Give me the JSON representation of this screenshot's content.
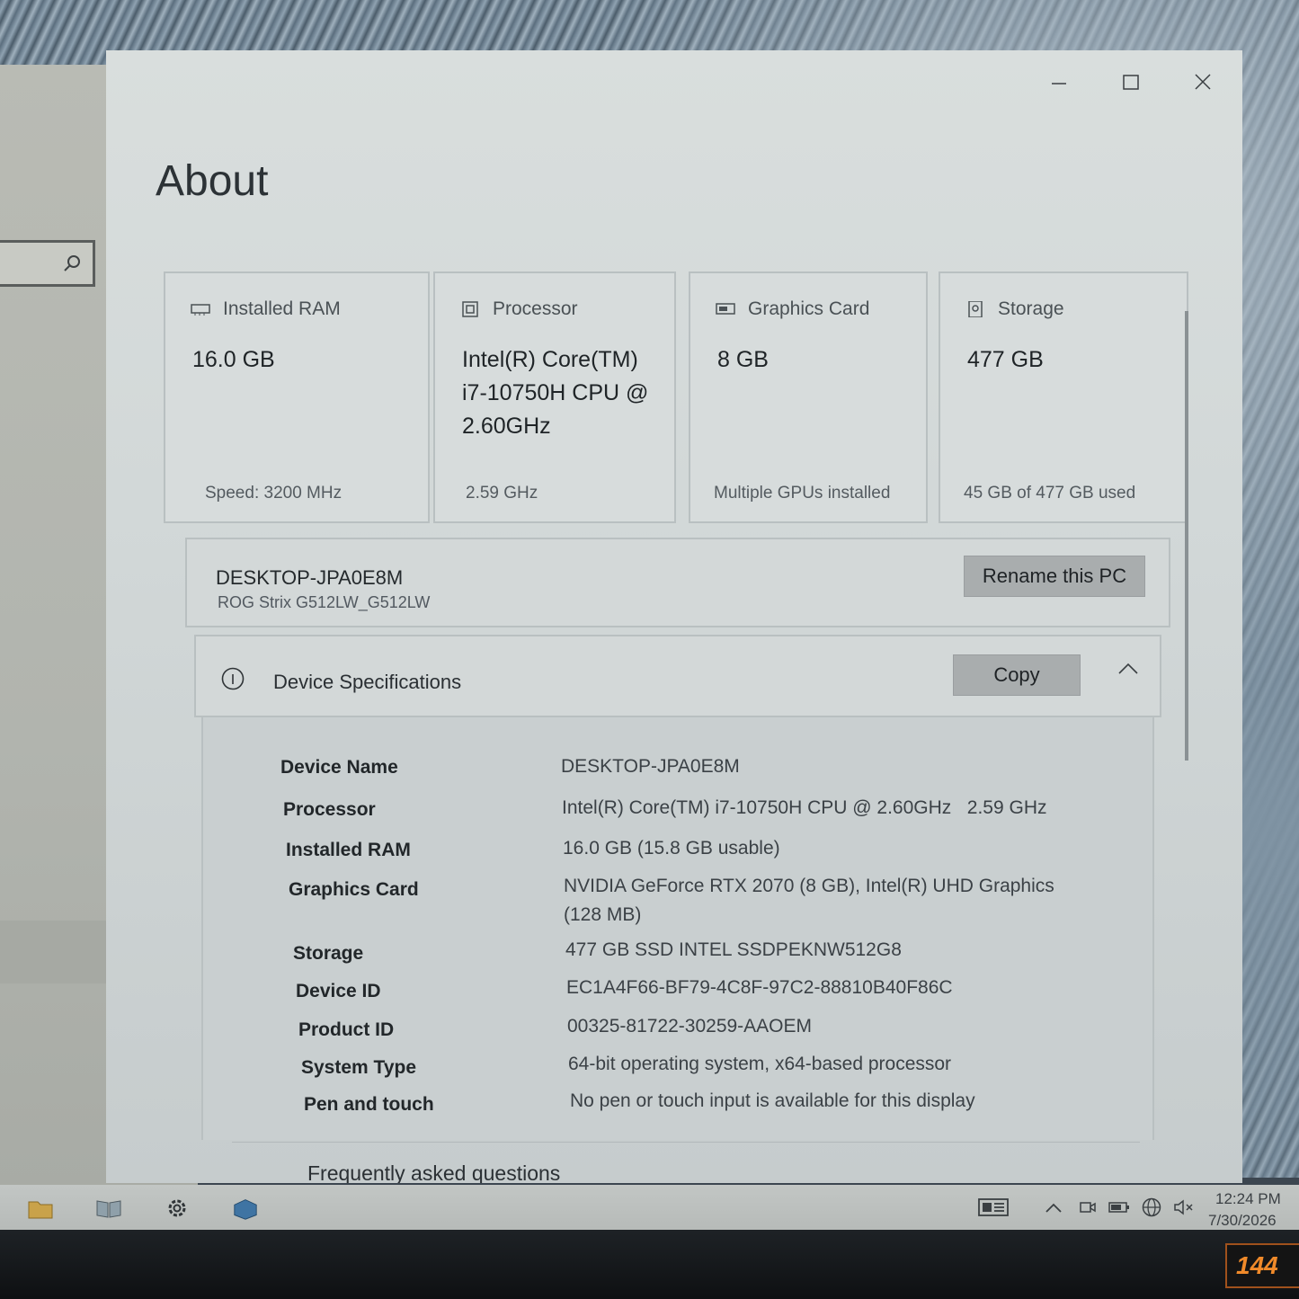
{
  "window": {
    "title": "About",
    "minimize_icon": "minimize-icon",
    "maximize_icon": "maximize-icon",
    "close_icon": "close-icon"
  },
  "cards": [
    {
      "label": "Installed RAM",
      "value": "16.0 GB",
      "sub": "Speed: 3200 MHz",
      "icon": "ram-icon"
    },
    {
      "label": "Processor",
      "value": "Intel(R) Core(TM) i7-10750H CPU @ 2.60GHz",
      "sub": "2.59 GHz",
      "icon": "processor-icon"
    },
    {
      "label": "Graphics Card",
      "value": "8 GB",
      "sub": "Multiple GPUs installed",
      "icon": "graphics-card-icon"
    },
    {
      "label": "Storage",
      "value": "477 GB",
      "sub": "45 GB of 477 GB used",
      "icon": "storage-icon"
    }
  ],
  "pc": {
    "name": "DESKTOP-JPA0E8M",
    "model": "ROG Strix G512LW_G512LW",
    "rename_label": "Rename this PC"
  },
  "specs": {
    "header": "Device Specifications",
    "copy_label": "Copy",
    "rows": [
      {
        "key": "Device Name",
        "value": "DESKTOP-JPA0E8M"
      },
      {
        "key": "Processor",
        "value": "Intel(R) Core(TM) i7-10750H CPU @ 2.60GHz   2.59 GHz"
      },
      {
        "key": "Installed RAM",
        "value": "16.0 GB (15.8 GB usable)"
      },
      {
        "key": "Graphics Card",
        "value": "NVIDIA GeForce RTX 2070 (8 GB), Intel(R) UHD Graphics (128 MB)"
      },
      {
        "key": "Storage",
        "value": "477 GB SSD INTEL SSDPEKNW512G8"
      },
      {
        "key": "Device ID",
        "value": "EC1A4F66-BF79-4C8F-97C2-88810B40F86C"
      },
      {
        "key": "Product ID",
        "value": "00325-81722-30259-AAOEM"
      },
      {
        "key": "System Type",
        "value": "64-bit operating system, x64-based processor"
      },
      {
        "key": "Pen and touch",
        "value": "No pen or touch input is available for this display"
      }
    ]
  },
  "faq": "Frequently asked questions",
  "taskbar": {
    "time": "12:24 PM",
    "date": "7/30/2026"
  },
  "monitor_badge": "144"
}
